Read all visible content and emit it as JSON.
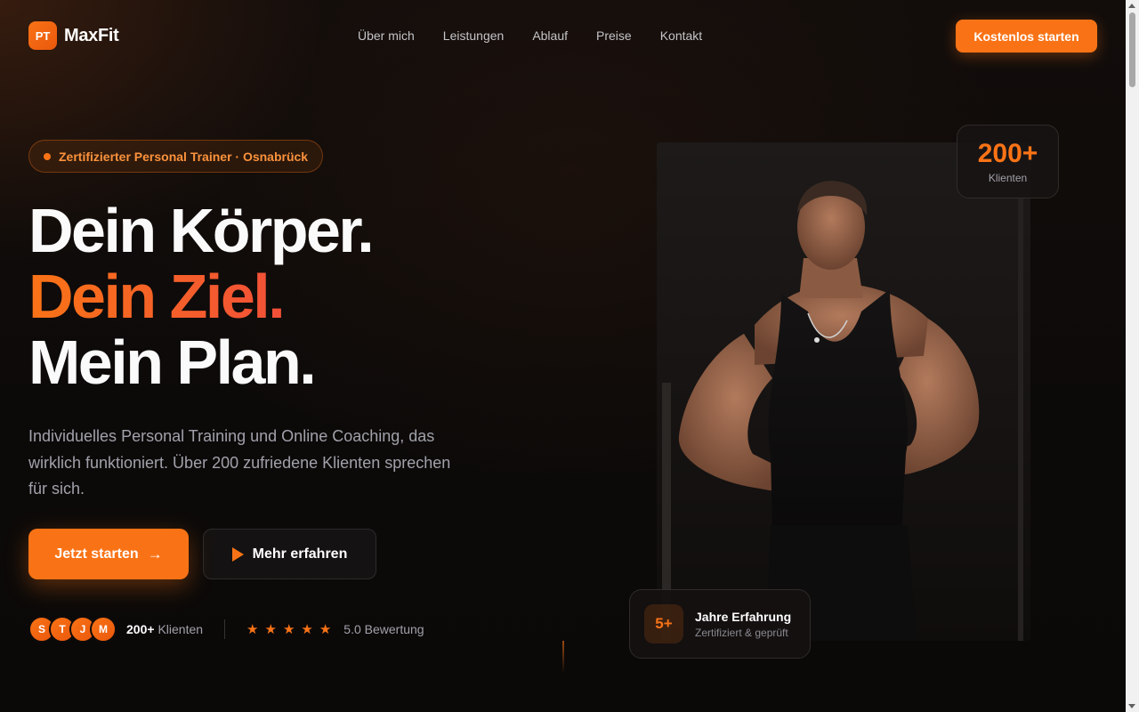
{
  "brand": {
    "badge": "PT",
    "name": "MaxFit"
  },
  "nav": {
    "links": [
      "Über mich",
      "Leistungen",
      "Ablauf",
      "Preise",
      "Kontakt"
    ],
    "cta": "Kostenlos starten"
  },
  "hero": {
    "badge": "Zertifizierter Personal Trainer · Osnabrück",
    "headline": [
      "Dein Körper.",
      "Dein Ziel.",
      "Mein Plan."
    ],
    "lead": "Individuelles Personal Training und Online Coaching, das wirklich funktioniert. Über 200 zufriedene Klienten sprechen für sich.",
    "primary_button": "Jetzt starten",
    "secondary_button": "Mehr erfahren",
    "avatars": [
      "S",
      "T",
      "J",
      "M"
    ],
    "clients_count": "200+",
    "clients_label": "Klienten",
    "stars": [
      "★",
      "★",
      "★",
      "★",
      "★"
    ],
    "rating": "5.0 Bewertung"
  },
  "stats": {
    "top": {
      "value": "200+",
      "label": "Klienten"
    },
    "bottom": {
      "value": "5+",
      "title": "Jahre Erfahrung",
      "subtitle": "Zertifiziert & geprüft"
    }
  },
  "colors": {
    "accent": "#f97316",
    "accent_red": "#ef4444",
    "background": "#0d0a09"
  },
  "icons": {
    "primary_button": "arrow-right-icon",
    "secondary_button": "play-icon",
    "rating": "star-icon"
  }
}
